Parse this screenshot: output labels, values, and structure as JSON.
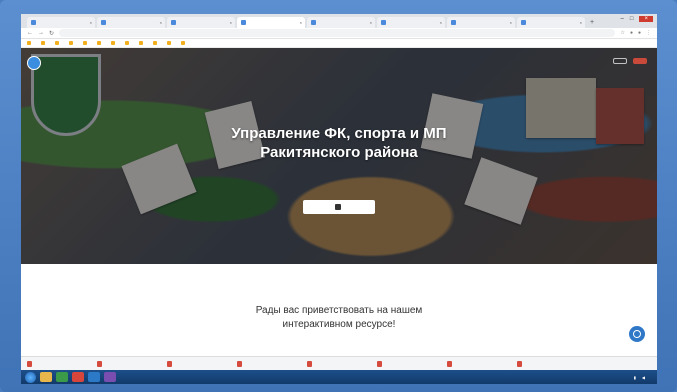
{
  "browser": {
    "tabs": [
      "",
      "",
      "",
      "",
      "",
      "",
      "",
      ""
    ],
    "active_tab": 3,
    "url": "",
    "bookmarks": [
      "",
      "",
      "",
      "",
      "",
      "",
      "",
      "",
      "",
      "",
      "",
      "",
      ""
    ]
  },
  "hero": {
    "site_name": "",
    "nav": [
      "",
      ""
    ],
    "actions": [
      "",
      ""
    ],
    "title_line1": "Управление ФК, спорта и МП",
    "title_line2": "Ракитянского района",
    "subtitle": "",
    "cta_label": ""
  },
  "section": {
    "welcome_line1": "Рады вас приветствовать на нашем",
    "welcome_line2": "интерактивном ресурсе!",
    "welcome_sub": ""
  },
  "downloads": {
    "items": [
      "",
      "",
      "",
      "",
      "",
      "",
      "",
      ""
    ],
    "show_all": ""
  },
  "taskbar": {
    "clock": ""
  },
  "colors": {
    "frame": "#4a7fbf",
    "accent_red": "#c94a3a",
    "chat": "#2f78c8"
  }
}
